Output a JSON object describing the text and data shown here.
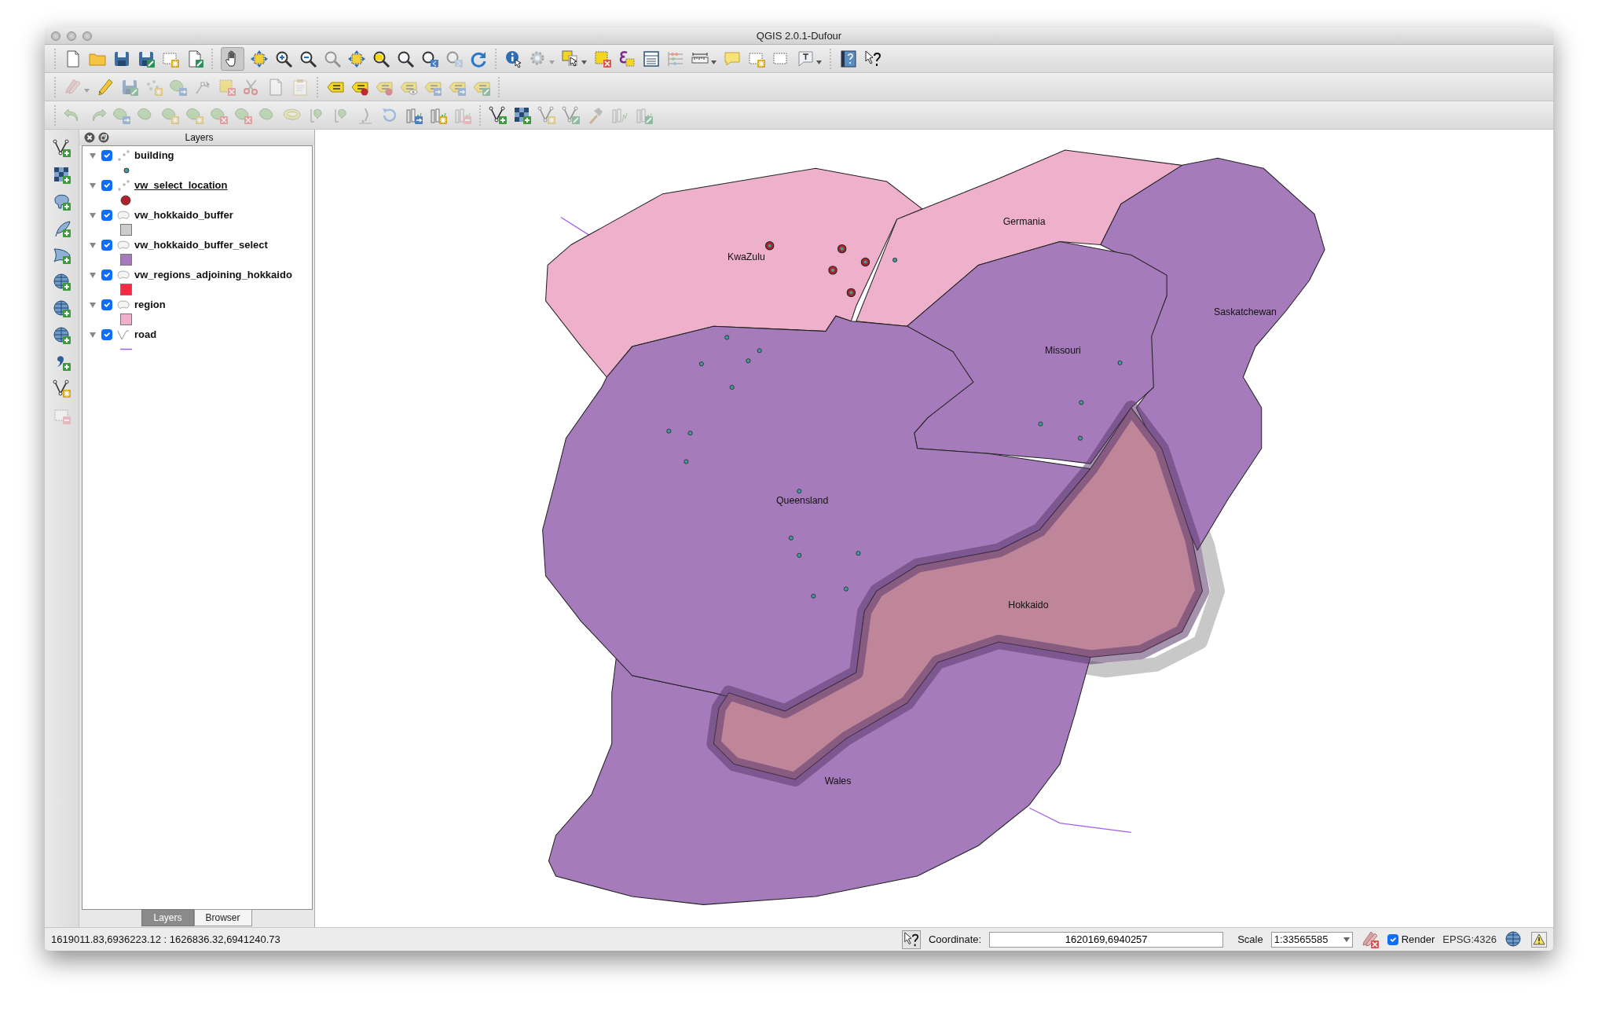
{
  "window": {
    "title": "QGIS 2.0.1-Dufour"
  },
  "layers_panel": {
    "title": "Layers",
    "layers": [
      {
        "name": "building",
        "kind": "point",
        "expanded": true,
        "checked": true,
        "selected": false,
        "color": "#3f9c98"
      },
      {
        "name": "vw_select_location",
        "kind": "bigpoint",
        "expanded": true,
        "checked": true,
        "selected": true,
        "color": "#b0222a"
      },
      {
        "name": "vw_hokkaido_buffer",
        "kind": "polygon",
        "expanded": true,
        "checked": true,
        "selected": false,
        "color": "#cccccc"
      },
      {
        "name": "vw_hokkaido_buffer_select",
        "kind": "polygon",
        "expanded": true,
        "checked": true,
        "selected": false,
        "color": "#a67bbb"
      },
      {
        "name": "vw_regions_adjoining_hokkaido",
        "kind": "polygon",
        "expanded": true,
        "checked": true,
        "selected": false,
        "color": "#fd2944"
      },
      {
        "name": "region",
        "kind": "polygon",
        "expanded": true,
        "checked": true,
        "selected": false,
        "color": "#efb0cc"
      },
      {
        "name": "road",
        "kind": "line",
        "expanded": true,
        "checked": true,
        "selected": false,
        "color": "#a061e8"
      }
    ],
    "tabs": [
      {
        "label": "Layers",
        "selected": true
      },
      {
        "label": "Browser",
        "selected": false
      }
    ]
  },
  "map": {
    "labels": [
      {
        "text": "KwaZulu"
      },
      {
        "text": "Germania"
      },
      {
        "text": "Saskatchewan"
      },
      {
        "text": "Missouri"
      },
      {
        "text": "Queensland"
      },
      {
        "text": "Hokkaido"
      },
      {
        "text": "Wales"
      }
    ]
  },
  "status_bar": {
    "extent": "1619011.83,6936223.12 : 1626836.32,6941240.73",
    "coordinate_label": "Coordinate:",
    "coordinate": "1620169,6940257",
    "scale_label": "Scale",
    "scale": "1:33565585",
    "render": {
      "label": "Render",
      "checked": true
    },
    "crs": "EPSG:4326"
  }
}
